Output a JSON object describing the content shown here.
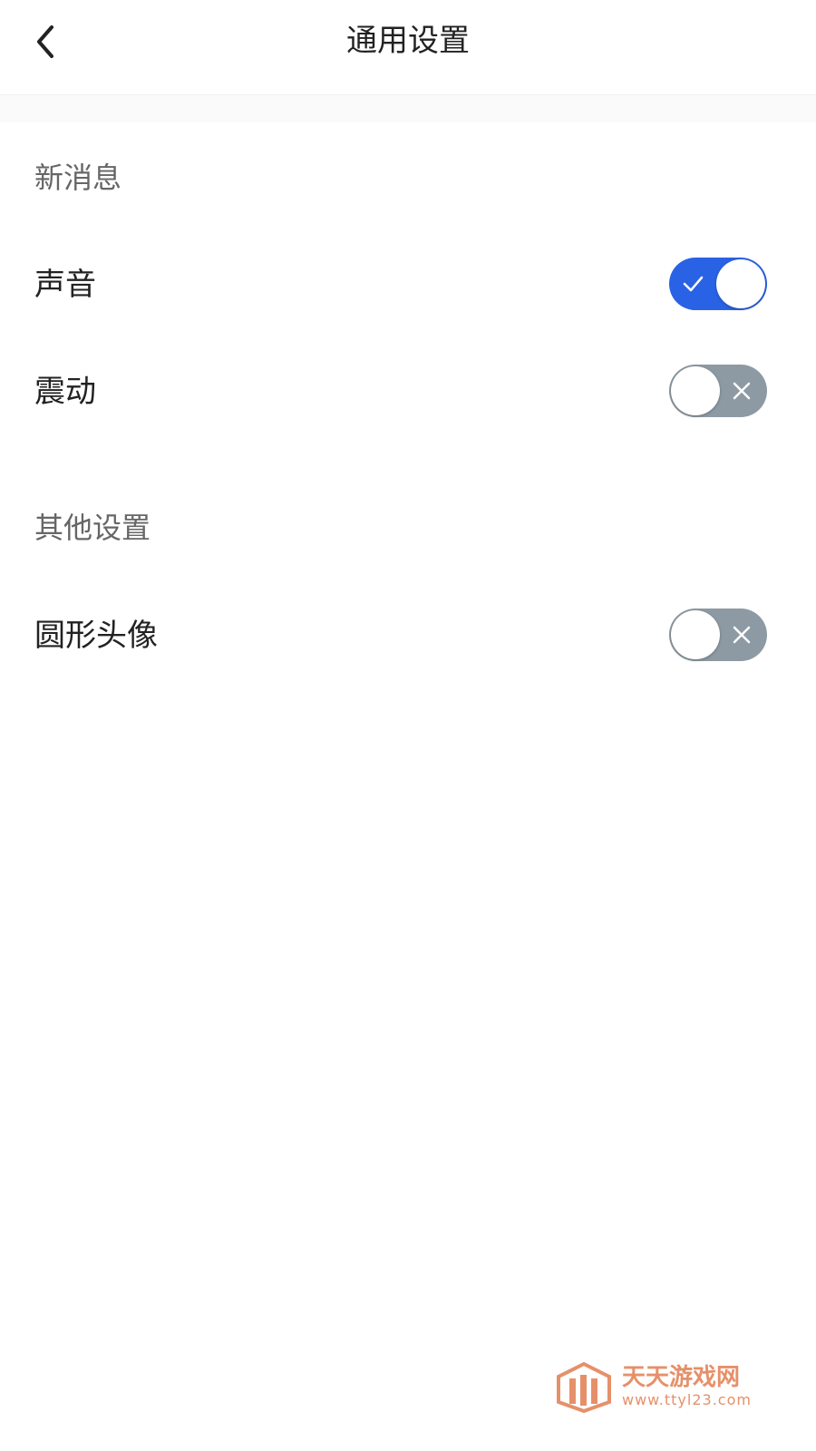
{
  "header": {
    "title": "通用设置",
    "back_icon": "chevron-left-icon"
  },
  "sections": [
    {
      "title": "新消息",
      "items": [
        {
          "label": "声音",
          "enabled": true
        },
        {
          "label": "震动",
          "enabled": false
        }
      ]
    },
    {
      "title": "其他设置",
      "items": [
        {
          "label": "圆形头像",
          "enabled": false
        }
      ]
    }
  ],
  "colors": {
    "toggle_on": "#2a62e6",
    "toggle_off": "#8d9aa3",
    "watermark": "#e6906a"
  },
  "watermark": {
    "name": "天天游戏网",
    "url": "www.ttyl23.com"
  }
}
